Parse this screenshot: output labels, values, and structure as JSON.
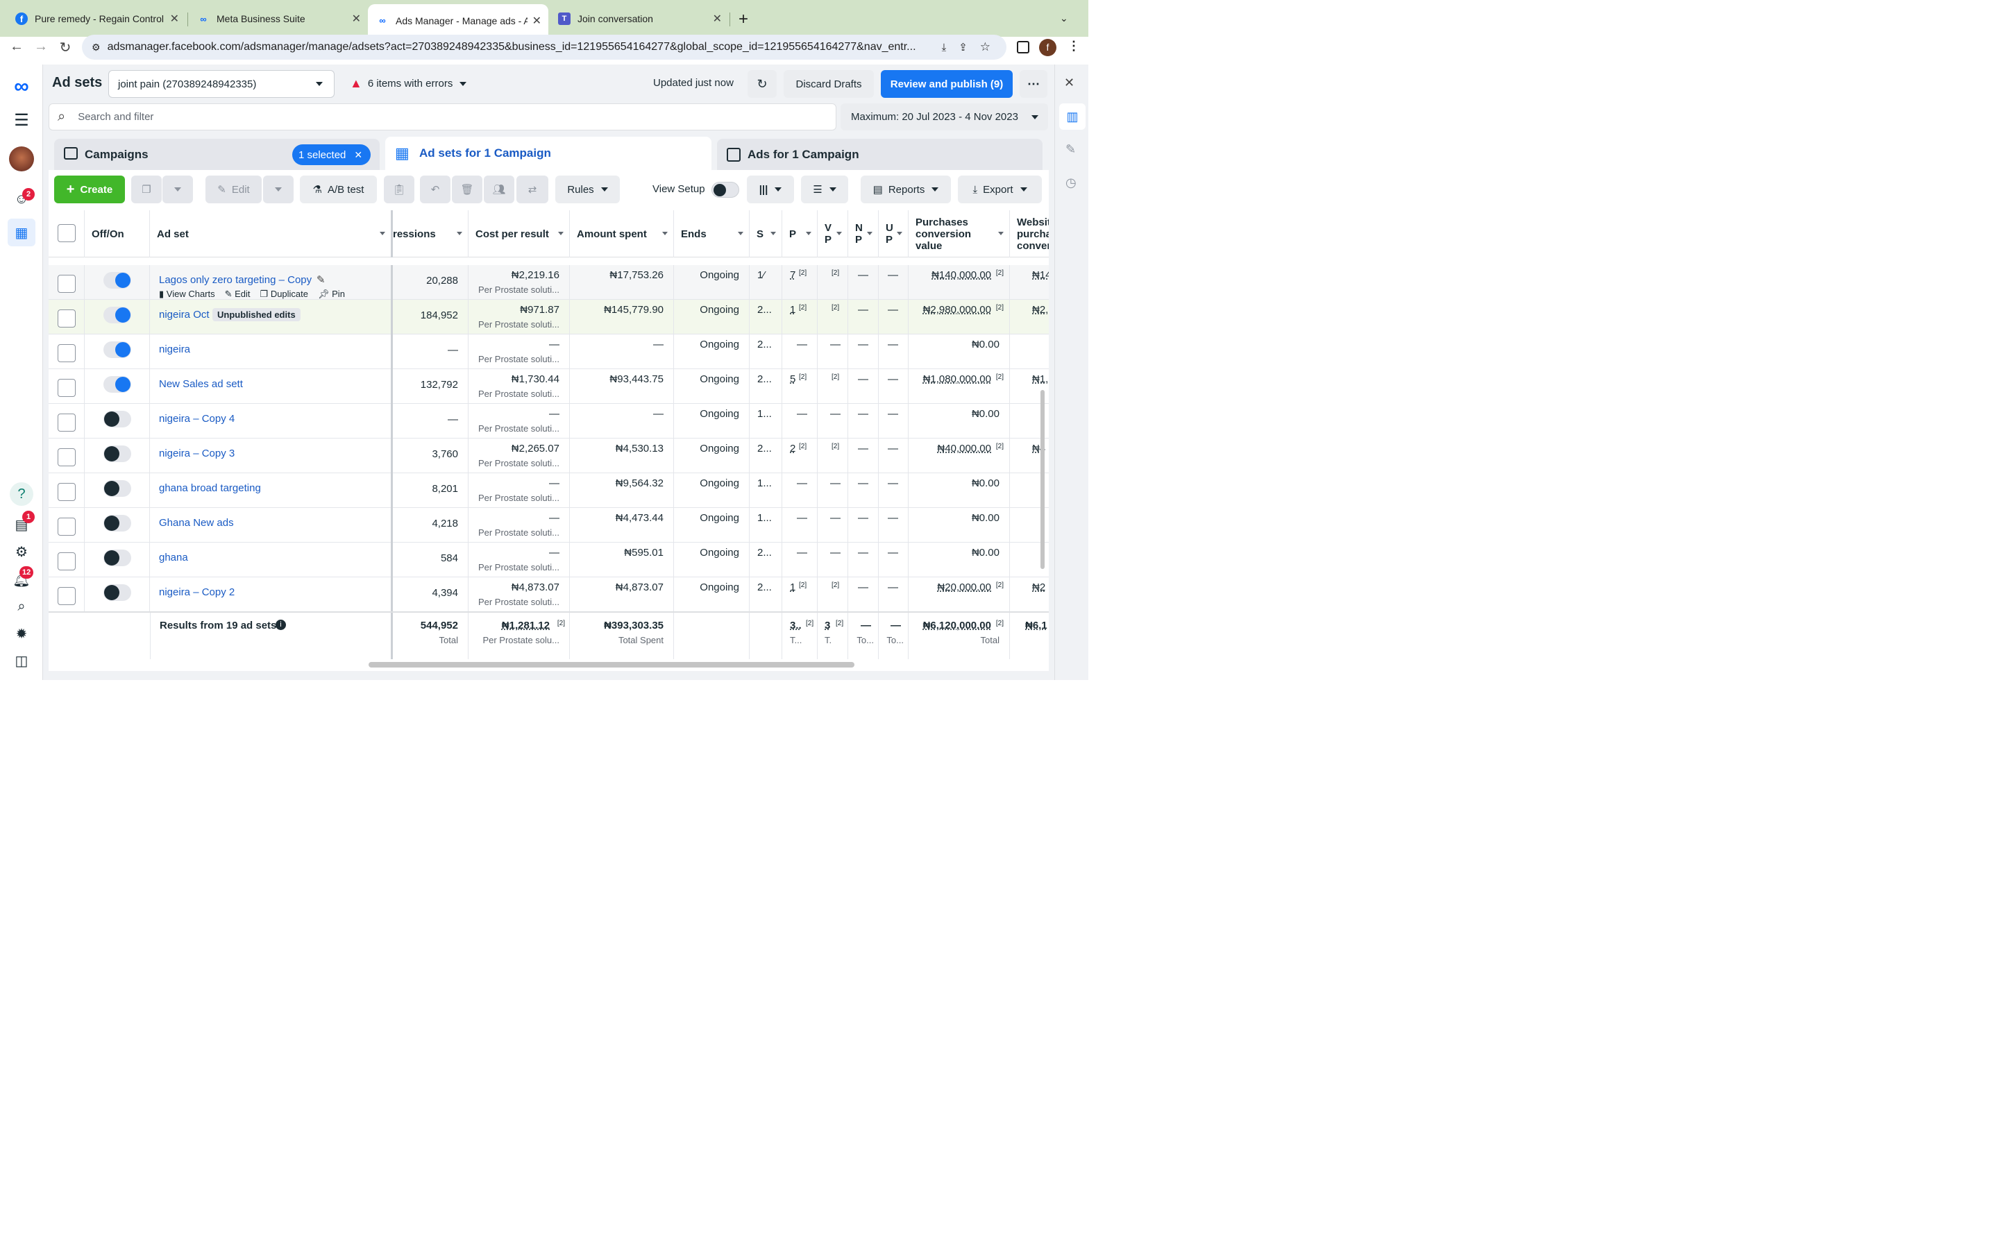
{
  "browser": {
    "tabs": [
      {
        "title": "Pure remedy - Regain Control",
        "icon": "facebook-icon"
      },
      {
        "title": "Meta Business Suite",
        "icon": "meta-icon"
      },
      {
        "title": "Ads Manager - Manage ads - A",
        "icon": "meta-icon"
      },
      {
        "title": "Join conversation",
        "icon": "teams-icon"
      }
    ],
    "url": "adsmanager.facebook.com/adsmanager/manage/adsets?act=270389248942335&business_id=121955654164277&global_scope_id=121955654164277&nav_entr...",
    "profile_initial": "f"
  },
  "leftnav": {
    "badges": {
      "notifications_page": "2",
      "alerts": "1",
      "notifications": "12"
    }
  },
  "header": {
    "title": "Ad sets",
    "account": "joint pain (270389248942335)",
    "errors": "6 items with errors",
    "updated": "Updated just now",
    "discard": "Discard Drafts",
    "publish": "Review and publish (9)"
  },
  "search": {
    "placeholder": "Search and filter",
    "date_range": "Maximum: 20 Jul 2023 - 4 Nov 2023"
  },
  "levels": {
    "campaigns": "Campaigns",
    "selected": "1 selected",
    "adsets": "Ad sets for 1 Campaign",
    "ads": "Ads for 1 Campaign"
  },
  "actions": {
    "create": "Create",
    "edit": "Edit",
    "ab_test": "A/B test",
    "rules": "Rules",
    "view_setup": "View Setup",
    "reports": "Reports",
    "export": "Export"
  },
  "columns": {
    "off_on": "Off/On",
    "ad_set": "Ad set",
    "impressions": "ressions",
    "cost_per_result": "Cost per result",
    "amount_spent": "Amount spent",
    "ends": "Ends",
    "s": "S",
    "p": "P",
    "v1": "V",
    "v1b": "P",
    "m": "N",
    "mb": "P",
    "u": "U",
    "ub": "P",
    "purchases_value": "Purchases conversion value",
    "website": "Websit purcha conver"
  },
  "hover_actions": {
    "view_charts": "View Charts",
    "edit": "Edit",
    "duplicate": "Duplicate",
    "pin": "Pin"
  },
  "rows": [
    {
      "name": "Lagos only zero targeting – Copy",
      "on": true,
      "impressions": "20,288",
      "cpr": "₦2,219.16",
      "cpr_sub": "Per Prostate soluti...",
      "spent": "₦17,753.26",
      "ends": "Ongoing",
      "s": "1⁄",
      "p": "7",
      "pv": "₦140,000.00",
      "web": "₦14"
    },
    {
      "name": "nigeira Oct",
      "badge": "Unpublished edits",
      "on": true,
      "impressions": "184,952",
      "cpr": "₦971.87",
      "cpr_sub": "Per Prostate soluti...",
      "spent": "₦145,779.90",
      "ends": "Ongoing",
      "s": "2...",
      "p": "1",
      "pv": "₦2,980,000.00",
      "web": "₦2,98"
    },
    {
      "name": "nigeira",
      "on": true,
      "impressions": "—",
      "cpr": "—",
      "cpr_sub": "Per Prostate soluti...",
      "spent": "—",
      "ends": "Ongoing",
      "s": "2...",
      "p": "—",
      "pv": "₦0.00",
      "web": ""
    },
    {
      "name": "New Sales ad sett",
      "on": true,
      "impressions": "132,792",
      "cpr": "₦1,730.44",
      "cpr_sub": "Per Prostate soluti...",
      "spent": "₦93,443.75",
      "ends": "Ongoing",
      "s": "2...",
      "p": "5",
      "pv": "₦1,080,000.00",
      "web": "₦1,08"
    },
    {
      "name": "nigeira – Copy 4",
      "on": false,
      "impressions": "—",
      "cpr": "—",
      "cpr_sub": "Per Prostate soluti...",
      "spent": "—",
      "ends": "Ongoing",
      "s": "1...",
      "p": "—",
      "pv": "₦0.00",
      "web": ""
    },
    {
      "name": "nigeira – Copy 3",
      "on": false,
      "impressions": "3,760",
      "cpr": "₦2,265.07",
      "cpr_sub": "Per Prostate soluti...",
      "spent": "₦4,530.13",
      "ends": "Ongoing",
      "s": "2...",
      "p": "2",
      "pv": "₦40,000.00",
      "web": "₦4"
    },
    {
      "name": "ghana broad targeting",
      "on": false,
      "impressions": "8,201",
      "cpr": "—",
      "cpr_sub": "Per Prostate soluti...",
      "spent": "₦9,564.32",
      "ends": "Ongoing",
      "s": "1...",
      "p": "—",
      "pv": "₦0.00",
      "web": ""
    },
    {
      "name": "Ghana New ads",
      "on": false,
      "impressions": "4,218",
      "cpr": "—",
      "cpr_sub": "Per Prostate soluti...",
      "spent": "₦4,473.44",
      "ends": "Ongoing",
      "s": "1...",
      "p": "—",
      "pv": "₦0.00",
      "web": ""
    },
    {
      "name": "ghana",
      "on": false,
      "impressions": "584",
      "cpr": "—",
      "cpr_sub": "Per Prostate soluti...",
      "spent": "₦595.01",
      "ends": "Ongoing",
      "s": "2...",
      "p": "—",
      "pv": "₦0.00",
      "web": ""
    },
    {
      "name": "nigeira – Copy 2",
      "on": false,
      "impressions": "4,394",
      "cpr": "₦4,873.07",
      "cpr_sub": "Per Prostate soluti...",
      "spent": "₦4,873.07",
      "ends": "Ongoing",
      "s": "2...",
      "p": "1",
      "pv": "₦20,000.00",
      "web": "₦2"
    }
  ],
  "footer": {
    "label": "Results from 19 ad sets",
    "impressions": "544,952",
    "impressions_sub": "Total",
    "cpr": "₦1,281.12",
    "cpr_sub": "Per Prostate solu...",
    "spent": "₦393,303.35",
    "spent_sub": "Total Spent",
    "p": "3..",
    "p_sub": "T...",
    "v": "3",
    "v_sub": "T.",
    "m": "—",
    "m_sub": "To...",
    "u": "—",
    "u_sub": "To...",
    "pv": "₦6,120,000.00",
    "pv_sub": "Total",
    "web": "₦6,1"
  },
  "ref": "[2]",
  "dash": "—",
  "colors": {
    "accent": "#1877f2",
    "create": "#42b72a",
    "link": "#1a5bc4",
    "error": "#e41e3f"
  }
}
